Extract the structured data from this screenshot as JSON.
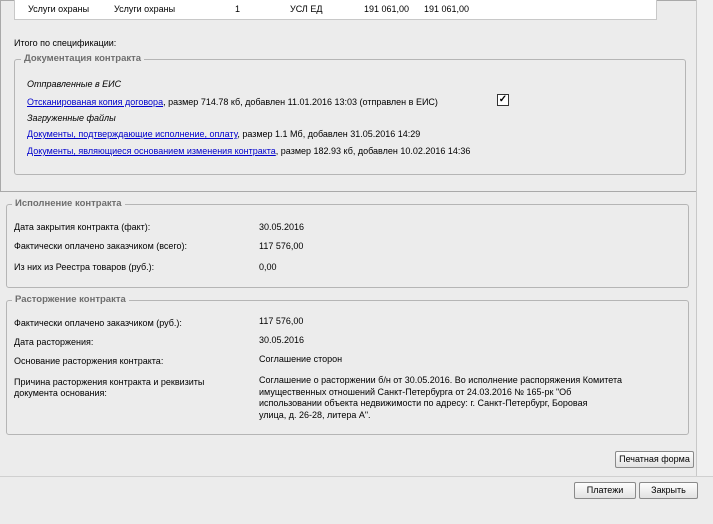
{
  "top_table": {
    "col1": "Услуги охраны",
    "col2": "Услуги охраны",
    "col3": "1",
    "col4": "УСЛ ЕД",
    "col5": "191 061,00",
    "col6": "191 061,00"
  },
  "spec_total_label": "Итого по спецификации:",
  "docs": {
    "legend": "Документация контракта",
    "sent_heading": "Отправленные в ЕИС",
    "sent_link": "Отсканированая копия договора",
    "sent_meta": ", размер 714.78 кб, добавлен 11.01.2016 13:03 (отправлен в ЕИС)",
    "loaded_heading": "Загруженные файлы",
    "file1_link": "Документы, подтверждающие исполнение, оплату",
    "file1_meta": ", размер 1.1 Мб, добавлен 31.05.2016 14:29",
    "file2_link": "Документы, являющиеся основанием изменения контракта",
    "file2_meta": ", размер 182.93 кб, добавлен 10.02.2016 14:36"
  },
  "execution": {
    "legend": "Исполнение контракта",
    "close_date_label": "Дата закрытия контракта (факт):",
    "close_date_value": "30.05.2016",
    "paid_label": "Фактически оплачено заказчиком (всего):",
    "paid_value": "117 576,00",
    "registry_label": "Из них из Реестра товаров (руб.):",
    "registry_value": "0,00"
  },
  "termination": {
    "legend": "Расторжение контракта",
    "paid_label": "Фактически оплачено заказчиком (руб.):",
    "paid_value": "117 576,00",
    "date_label": "Дата расторжения:",
    "date_value": "30.05.2016",
    "basis_label": "Основание расторжения контракта:",
    "basis_value": "Соглашение сторон",
    "reason_label_line1": "Причина расторжения контракта и реквизиты",
    "reason_label_line2": "документа основания:",
    "reason_line1": "Соглашение о расторжении б/н от 30.05.2016. Во исполнение распоряжения Комитета",
    "reason_line2": "имущественных отношений Санкт-Петербурга от 24.03.2016 № 165-рк \"Об",
    "reason_line3": "использовании объекта недвижимости по адресу: г. Санкт-Петербург, Боровая",
    "reason_line4": "улица, д. 26-28, литера А\"."
  },
  "buttons": {
    "print_form": "Печатная форма",
    "payments": "Платежи",
    "close": "Закрыть"
  }
}
